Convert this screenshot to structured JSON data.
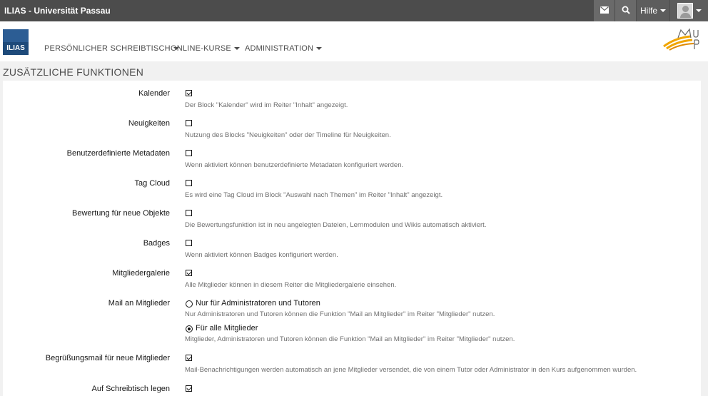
{
  "topbar": {
    "title": "ILIAS - Universität Passau",
    "help_label": "Hilfe"
  },
  "icons": {
    "mail": "mail-icon",
    "search": "search-icon",
    "user": "user-avatar-icon"
  },
  "header": {
    "logo_text": "ILIAS",
    "nav": [
      {
        "label": "PERSÖNLICHER SCHREIBTISCH"
      },
      {
        "label": "ONLINE-KURSE"
      },
      {
        "label": "ADMINISTRATION"
      }
    ]
  },
  "page": {
    "title": "ZUSÄTZLICHE FUNKTIONEN"
  },
  "settings": [
    {
      "label": "Kalender",
      "checked": true,
      "description": "Der Block \"Kalender\" wird im Reiter \"Inhalt\" angezeigt."
    },
    {
      "label": "Neuigkeiten",
      "checked": false,
      "description": "Nutzung des Blocks \"Neuigkeiten\" oder der Timeline für Neuigkeiten."
    },
    {
      "label": "Benutzerdefinierte Metadaten",
      "checked": false,
      "description": "Wenn aktiviert können benutzerdefinierte Metadaten konfiguriert werden."
    },
    {
      "label": "Tag Cloud",
      "checked": false,
      "description": "Es wird eine Tag Cloud im Block \"Auswahl nach Themen\" im Reiter \"Inhalt\" angezeigt."
    },
    {
      "label": "Bewertung für neue Objekte",
      "checked": false,
      "description": "Die Bewertungsfunktion ist in neu angelegten Dateien, Lernmodulen und Wikis automatisch aktiviert."
    },
    {
      "label": "Badges",
      "checked": false,
      "description": "Wenn aktiviert können Badges konfiguriert werden."
    },
    {
      "label": "Mitgliedergalerie",
      "checked": true,
      "description": "Alle Mitglieder können in diesem Reiter die Mitgliedergalerie einsehen."
    }
  ],
  "mail_members": {
    "label": "Mail an Mitglieder",
    "options": [
      {
        "label": "Nur für Administratoren und Tutoren",
        "selected": false,
        "description": "Nur Administratoren und Tutoren können die Funktion \"Mail an Mitglieder\" im Reiter \"Mitglieder\" nutzen."
      },
      {
        "label": "Für alle Mitglieder",
        "selected": true,
        "description": "Mitglieder, Administratoren und Tutoren können die Funktion \"Mail an Mitglieder\" im Reiter \"Mitglieder\" nutzen."
      }
    ]
  },
  "welcome_mail": {
    "label": "Begrüßungsmail für neue Mitglieder",
    "checked": true,
    "description": "Mail-Benachrichtigungen werden automatisch an jene Mitglieder versendet, die von einem Tutor oder Administrator in den Kurs aufgenommen wurden."
  },
  "desktop": {
    "label": "Auf Schreibtisch legen",
    "checked": true
  }
}
